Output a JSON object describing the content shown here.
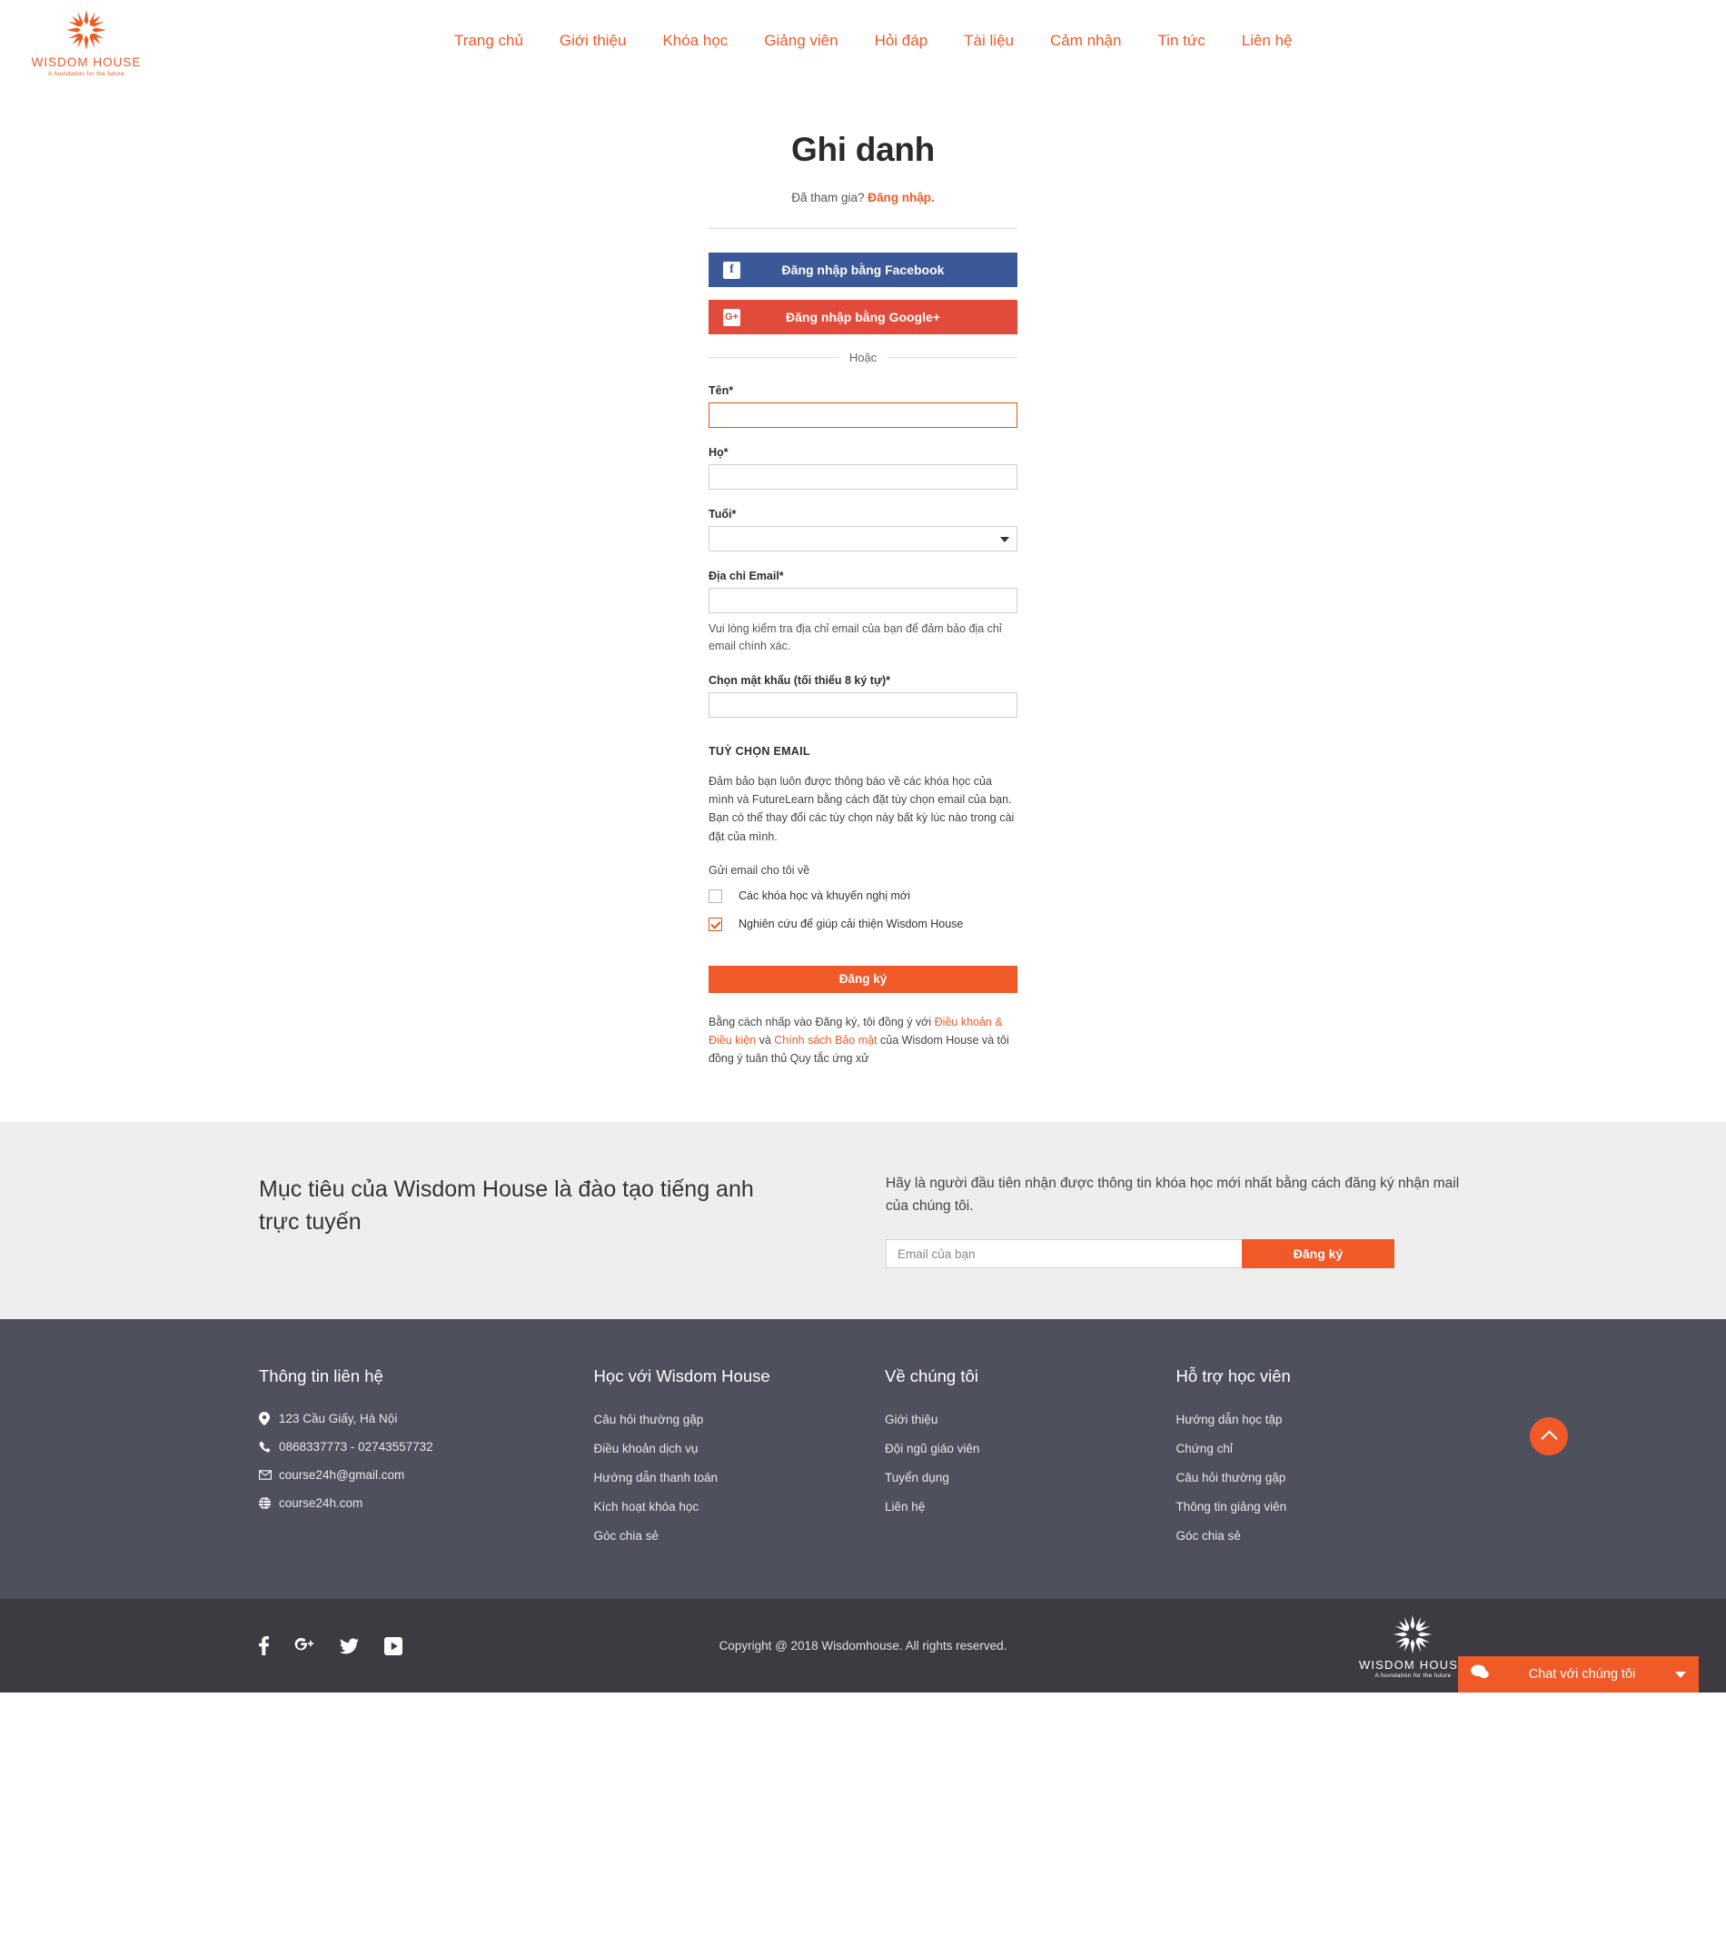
{
  "header": {
    "logo": {
      "name": "WISDOM HOUSE",
      "tagline": "A foundation for the future",
      "color": "#ee5a24"
    },
    "nav": [
      {
        "label": "Trang chủ",
        "name": "nav-trang-chu"
      },
      {
        "label": "Giới thiệu",
        "name": "nav-gioi-thieu"
      },
      {
        "label": "Khóa học",
        "name": "nav-khoa-hoc"
      },
      {
        "label": "Giảng viên",
        "name": "nav-giang-vien"
      },
      {
        "label": "Hỏi đáp",
        "name": "nav-hoi-dap"
      },
      {
        "label": "Tài liệu",
        "name": "nav-tai-lieu"
      },
      {
        "label": "Cảm nhận",
        "name": "nav-cam-nhan"
      },
      {
        "label": "Tin tức",
        "name": "nav-tin-tuc"
      },
      {
        "label": "Liên hệ",
        "name": "nav-lien-he"
      }
    ]
  },
  "signup": {
    "title": "Ghi danh",
    "already_text": "Đã tham gia?",
    "login_link": "Đăng nhập.",
    "facebook_button": "Đăng nhập bằng Facebook",
    "facebook_icon": "facebook-icon",
    "facebook_color": "#3b5998",
    "google_button": "Đăng nhập bằng Google+",
    "google_icon": "google-plus-icon",
    "google_color": "#e24b3b",
    "or_label": "Hoặc",
    "fields": {
      "first_name_label": "Tên*",
      "first_name_value": "",
      "last_name_label": "Họ*",
      "last_name_value": "",
      "age_label": "Tuổi*",
      "age_value": "",
      "age_options": [
        ""
      ],
      "email_label": "Địa chỉ Email*",
      "email_value": "",
      "email_help": "Vui lòng kiểm tra địa chỉ email của bạn để đảm bảo địa chỉ email chính xác.",
      "password_label": "Chọn mật khẩu (tối thiểu 8 ký tự)*",
      "password_value": ""
    },
    "email_options": {
      "heading": "TUỲ CHỌN EMAIL",
      "paragraph": "Đảm bảo bạn luôn được thông báo về các khóa học của mình và FutureLearn bằng cách đặt tùy chọn email của bạn. Bạn có thể thay đổi các tùy chọn này bất kỳ lúc nào trong cài đặt của mình.",
      "send_label": "Gửi email cho tôi về",
      "checkboxes": [
        {
          "label": "Các khóa học và khuyến nghị mới",
          "checked": false
        },
        {
          "label": "Nghiên cứu để giúp cải thiện Wisdom House",
          "checked": true
        }
      ]
    },
    "submit_button": "Đăng ký",
    "terms": {
      "prefix": "Bằng cách nhấp vào Đăng ký, tôi đồng ý với ",
      "link1": "Điều khoản & Điều kiện",
      "mid": " và ",
      "link2": "Chính sách Bảo mật",
      "suffix": " của Wisdom House và tôi đồng ý tuân thủ Quy tắc ứng xử"
    }
  },
  "newsletter": {
    "heading": "Mục tiêu của Wisdom House là đào tạo tiếng anh trực tuyến",
    "description": "Hãy là người đầu tiên nhận được thông tin khóa học mới nhất bằng cách đăng ký nhận mail của chúng tôi.",
    "input_placeholder": "Email của bạn",
    "input_value": "",
    "button_label": "Đăng ký"
  },
  "footer": {
    "columns": [
      {
        "title": "Thông tin liên hệ",
        "type": "contact",
        "items": [
          {
            "icon": "location-pin-icon",
            "text": "123 Cầu Giấy, Hà Nội"
          },
          {
            "icon": "phone-icon",
            "text": "0868337773 - 02743557732"
          },
          {
            "icon": "envelope-icon",
            "text": "course24h@gmail.com"
          },
          {
            "icon": "globe-icon",
            "text": "course24h.com"
          }
        ]
      },
      {
        "title": "Học với Wisdom House",
        "type": "links",
        "items": [
          {
            "text": "Câu hỏi thường gặp"
          },
          {
            "text": "Điều khoản dịch vụ"
          },
          {
            "text": "Hướng dẫn thanh toán"
          },
          {
            "text": "Kích hoạt khóa học"
          },
          {
            "text": "Góc chia sẻ"
          }
        ]
      },
      {
        "title": "Về chúng tôi",
        "type": "links",
        "items": [
          {
            "text": "Giới thiệu"
          },
          {
            "text": "Đội ngũ giáo viên"
          },
          {
            "text": "Tuyển dụng"
          },
          {
            "text": "Liên hệ"
          }
        ]
      },
      {
        "title": "Hỗ trợ học viên",
        "type": "links",
        "items": [
          {
            "text": "Hướng dẫn học tập"
          },
          {
            "text": "Chứng chỉ"
          },
          {
            "text": "Câu hỏi thường gặp"
          },
          {
            "text": "Thông tin giảng viên"
          },
          {
            "text": "Góc chia sẻ"
          }
        ]
      }
    ],
    "back_to_top_icon": "chevron-up-icon",
    "social": [
      {
        "icon": "facebook-icon",
        "glyph": "f"
      },
      {
        "icon": "google-plus-icon",
        "glyph": "g+"
      },
      {
        "icon": "twitter-icon",
        "glyph": "t"
      },
      {
        "icon": "youtube-icon",
        "glyph": "yt"
      }
    ],
    "copyright": "Copyright @ 2018 Wisdomhouse. All rights reserved.",
    "logo": {
      "name": "WISDOM HOUSE",
      "tagline": "A foundation for the future"
    },
    "chat": {
      "label": "Chat với chúng tôi",
      "icon": "chat-bubble-icon",
      "color": "#f05a28"
    }
  }
}
